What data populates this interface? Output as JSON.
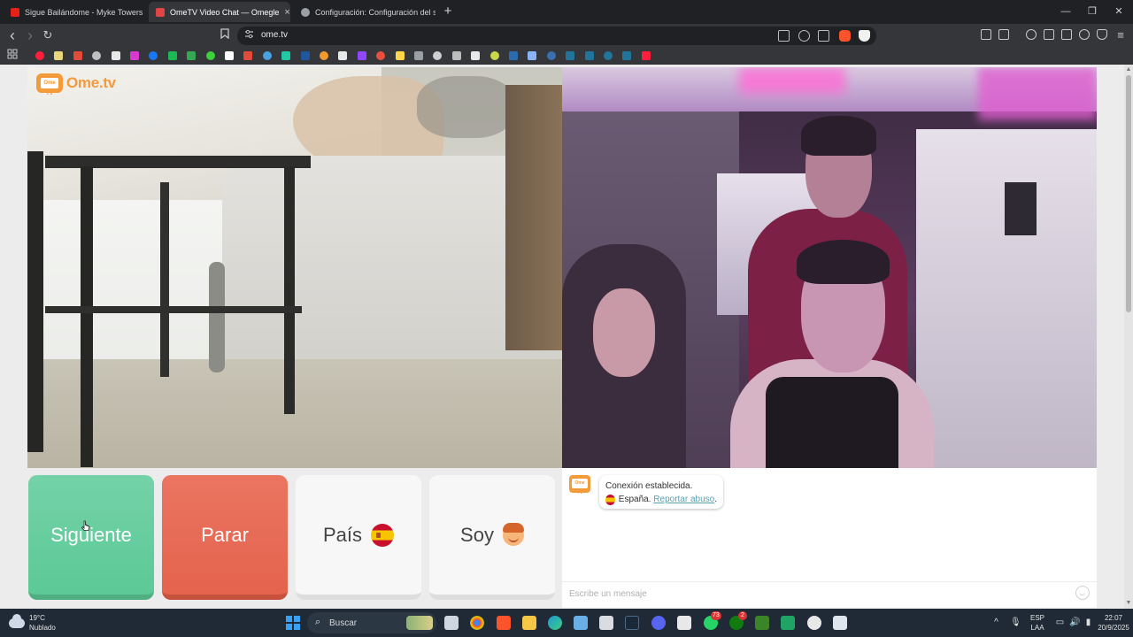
{
  "browser": {
    "tabs": [
      {
        "title": "Sigue Bailándome - Myke Towers - Yo",
        "favicon_color": "#e62117",
        "active": false
      },
      {
        "title": "OmeTV Video Chat — Omegle",
        "favicon_color": "#e04545",
        "active": true
      },
      {
        "title": "Configuración: Configuración del sitio",
        "favicon_color": "#9aa0a6",
        "active": false
      }
    ],
    "tab_close_glyph": "×",
    "new_tab_glyph": "+",
    "window_controls": {
      "minimize": "—",
      "maximize": "❐",
      "close": "✕"
    },
    "address": "ome.tv",
    "nav": {
      "back": "‹",
      "forward": "›",
      "reload": "↻"
    }
  },
  "bookmark_colors": [
    "#ff1f3d",
    "#e8d77a",
    "#e24a3a",
    "#c0c0c0",
    "#e8e8e8",
    "#d63ad1",
    "#1877f2",
    "#1db954",
    "#34a853",
    "#3ad13a",
    "#ffffff",
    "#e24a3a",
    "#4aa0e2",
    "#23c6a5",
    "#1e56a0",
    "#f29a2e",
    "#e8e8e8",
    "#9146ff",
    "#e94f3d",
    "#ffd54a",
    "#9aa0a6",
    "#d0d0d0",
    "#bdbdbd",
    "#e8e8e8",
    "#c8d84a",
    "#2b6cb0",
    "#8ab4f8",
    "#3a6fb0",
    "#21759b",
    "#21759b",
    "#21759b",
    "#21759b",
    "#ff1f3d"
  ],
  "page": {
    "logo_text": "Ome.tv",
    "logo_badge": "Ome TV"
  },
  "controls": {
    "next_label": "Siguiente",
    "stop_label": "Parar",
    "country_label": "País",
    "gender_label": "Soy"
  },
  "chat": {
    "status": "Conexión establecida.",
    "country": "España.",
    "report_link": "Reportar abuso",
    "report_suffix": ".",
    "input_placeholder": "Escribe un mensaje"
  },
  "taskbar": {
    "temperature": "19°C",
    "weather": "Nublado",
    "search_label": "Buscar",
    "search_glyph": "⌕",
    "whatsapp_badge": "73",
    "xbox_badge": "2",
    "tray_caret": "^",
    "tray_mic": "🎙",
    "language_line1": "ESP",
    "language_line2": "LAA",
    "tray_network": "▭",
    "tray_volume": "🔊",
    "tray_battery": "▮",
    "time": "22:07",
    "date": "20/9/2025"
  }
}
